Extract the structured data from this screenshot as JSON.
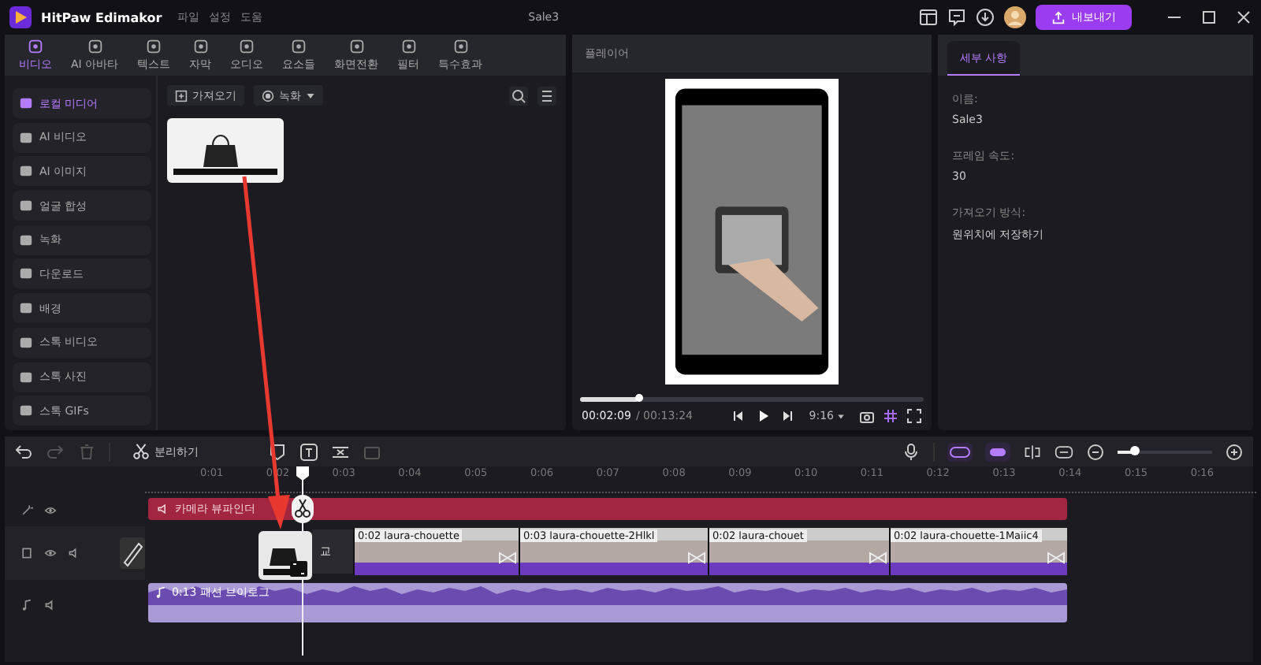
{
  "window": {
    "app_name": "HitPaw Edimakor",
    "menus": [
      "파일",
      "설정",
      "도움"
    ],
    "project_title": "Sale3",
    "export_label": "내보내기"
  },
  "toolbar_tabs": [
    {
      "label": "비디오",
      "selected": true
    },
    {
      "label": "AI 아바타",
      "selected": false
    },
    {
      "label": "텍스트",
      "selected": false
    },
    {
      "label": "자막",
      "selected": false
    },
    {
      "label": "오디오",
      "selected": false
    },
    {
      "label": "요소들",
      "selected": false
    },
    {
      "label": "화면전환",
      "selected": false
    },
    {
      "label": "필터",
      "selected": false
    },
    {
      "label": "특수효과",
      "selected": false
    }
  ],
  "sidebar": {
    "items": [
      {
        "label": "로컬 미디어",
        "selected": true
      },
      {
        "label": "AI 비디오",
        "selected": false
      },
      {
        "label": "AI 이미지",
        "selected": false
      },
      {
        "label": "얼굴 합성",
        "selected": false
      },
      {
        "label": "녹화",
        "selected": false
      },
      {
        "label": "다운로드",
        "selected": false
      },
      {
        "label": "배경",
        "selected": false
      },
      {
        "label": "스톡 비디오",
        "selected": false
      },
      {
        "label": "스톡 사진",
        "selected": false
      },
      {
        "label": "스톡 GIFs",
        "selected": false
      }
    ]
  },
  "media": {
    "import_label": "가져오기",
    "record_label": "녹화"
  },
  "player": {
    "title": "플레이어",
    "level": 0.17,
    "current_time": "00:02:09",
    "total_time": "/ 00:13:24",
    "aspect": "9:16"
  },
  "details": {
    "tab": "세부 사항",
    "fields": [
      {
        "label": "이름:",
        "value": "Sale3"
      },
      {
        "label": "프레임 속도:",
        "value": "30"
      },
      {
        "label": "가져오기 방식:",
        "value": "원위치에 저장하기"
      }
    ]
  },
  "timeline": {
    "split_label": "분리하기",
    "zoom": {
      "level": 0.18
    },
    "ruler": [
      "0:01",
      "0:02",
      "0:03",
      "0:04",
      "0:05",
      "0:06",
      "0:07",
      "0:08",
      "0:09",
      "0:10",
      "0:11",
      "0:12",
      "0:13",
      "0:14",
      "0:15",
      "0:16"
    ],
    "text_track": {
      "label": "카메라 뷰파인더"
    },
    "video_clips": [
      {
        "label": "교",
        "kind": "ghost"
      },
      {
        "label": "0:02 laura-chouette",
        "kind": "clip"
      },
      {
        "label": "0:03 laura-chouette-2Hlkl",
        "kind": "clip"
      },
      {
        "label": "0:02 laura-chouet",
        "kind": "clip"
      },
      {
        "label": "0:02 laura-chouette-1Maiic4",
        "kind": "clip"
      }
    ],
    "audio_track": {
      "label": "0:13 패션 브이로그"
    }
  }
}
